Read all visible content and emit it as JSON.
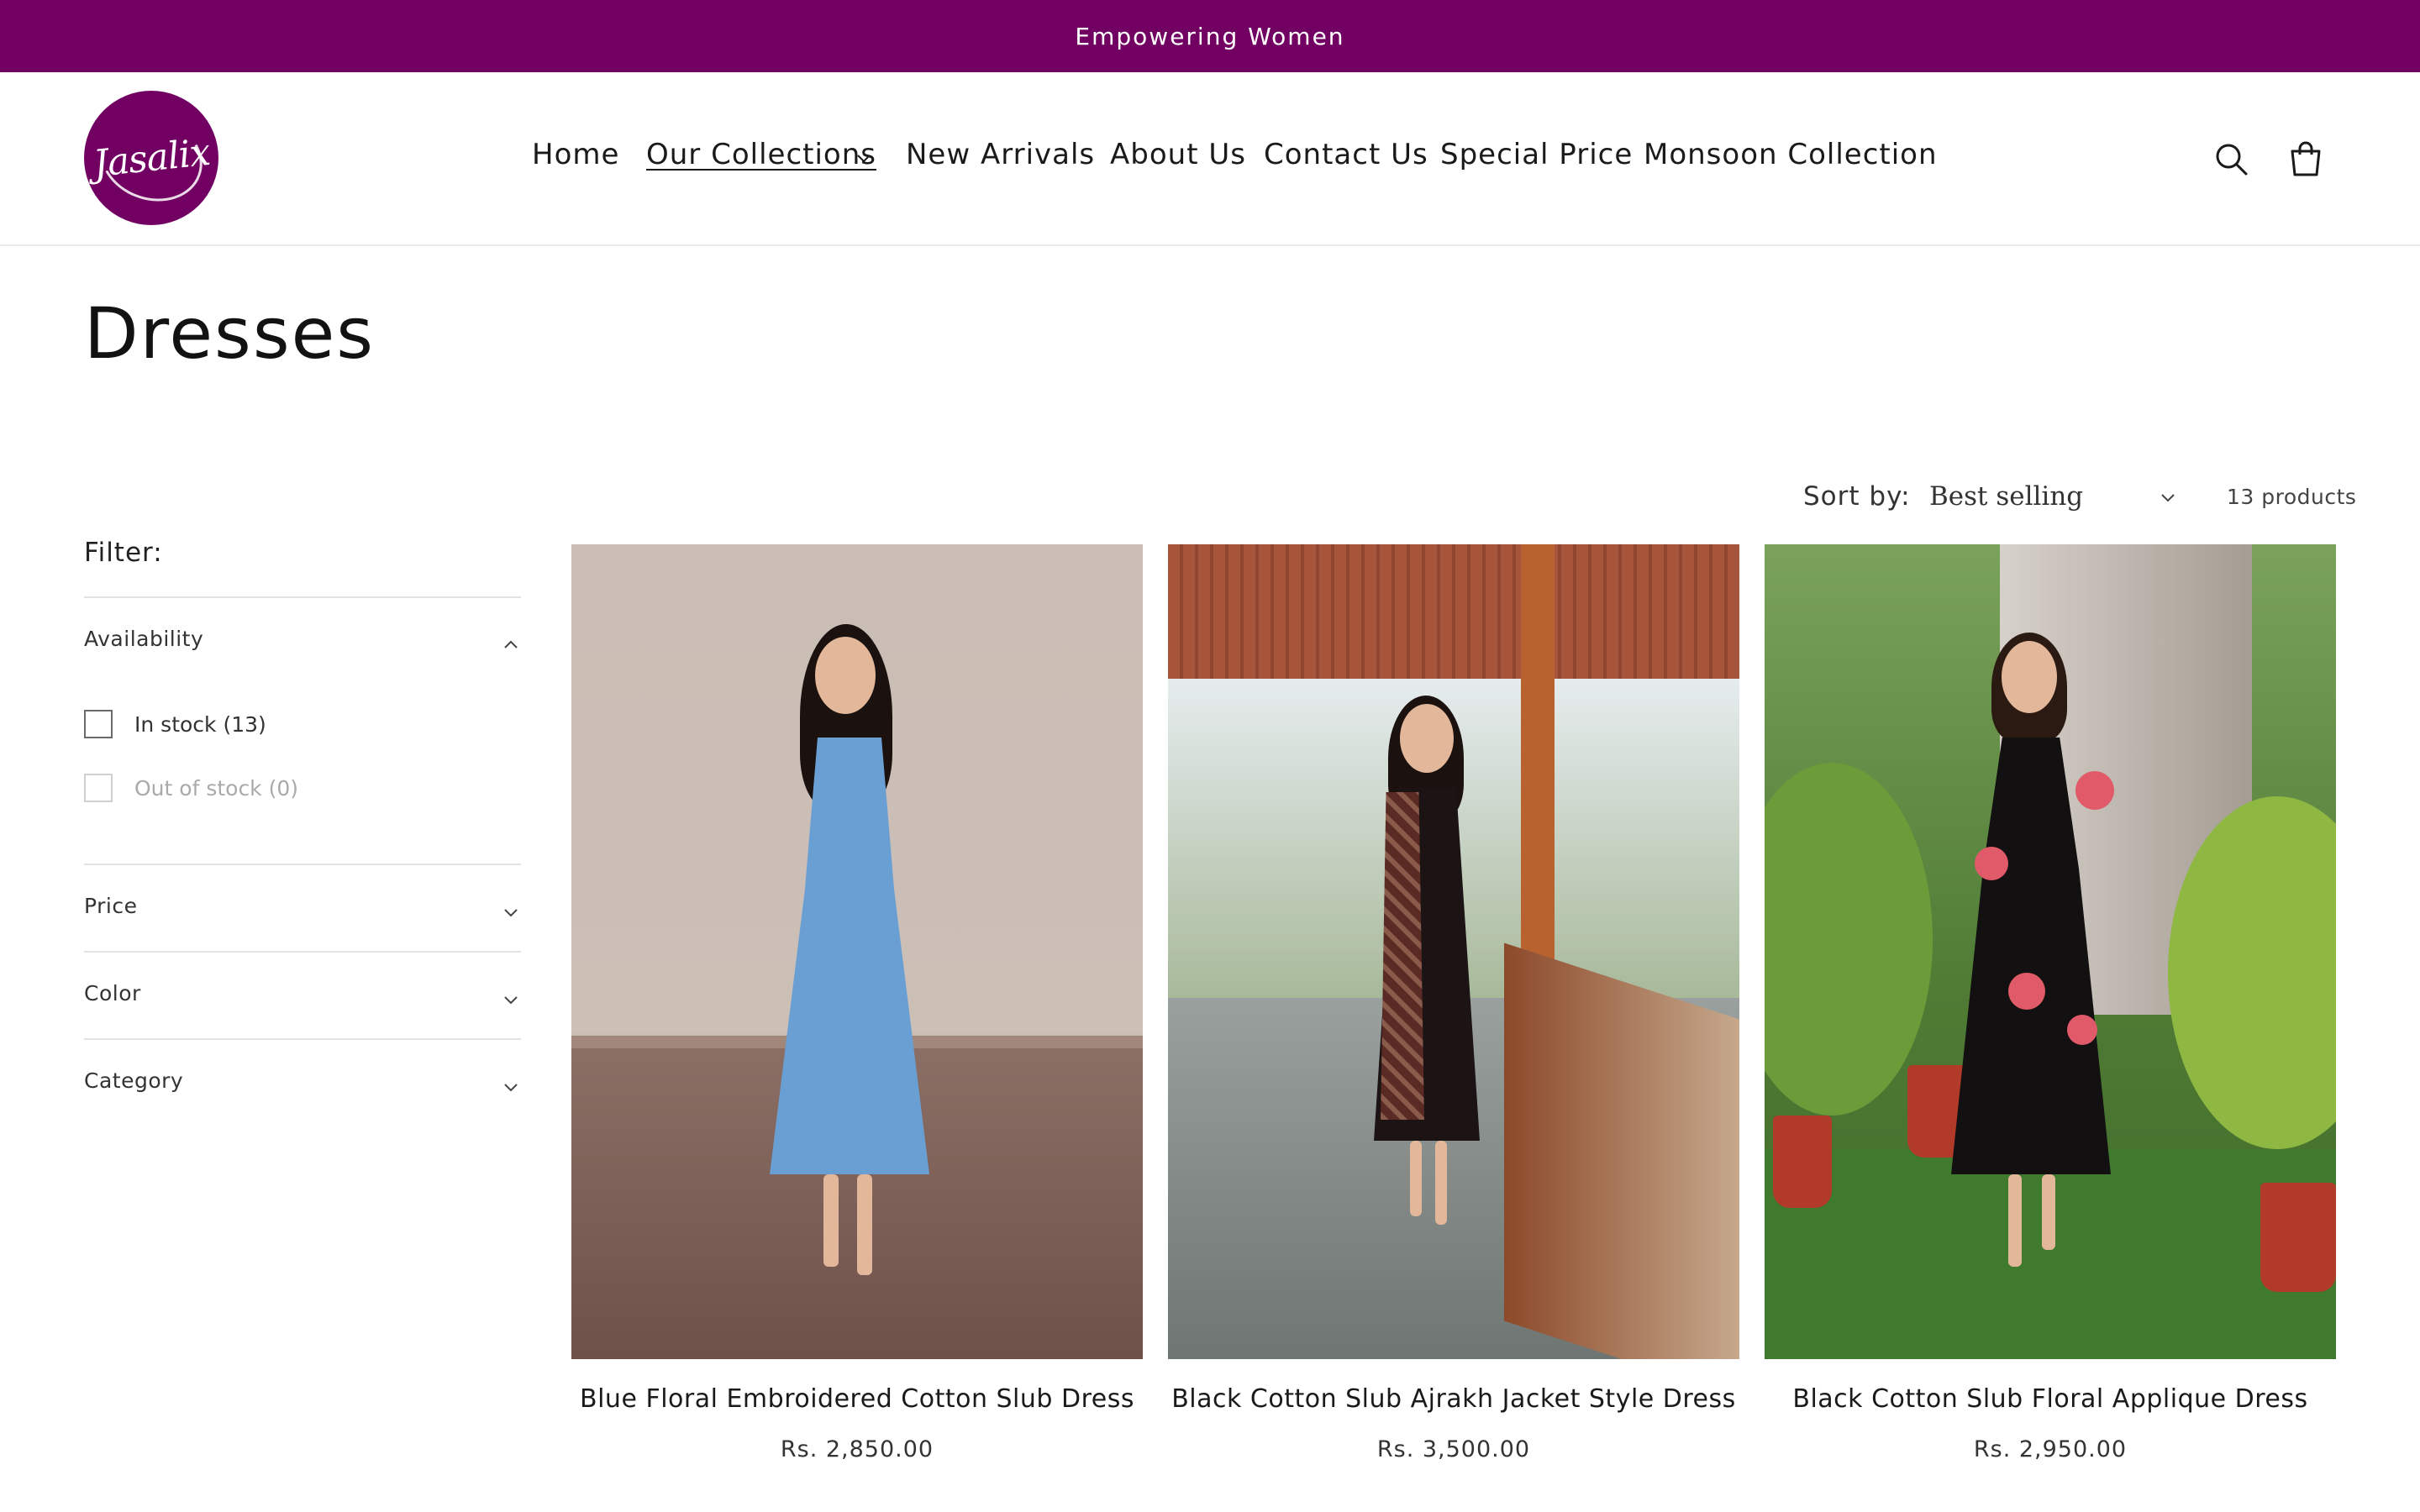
{
  "announcement": {
    "text": "Empowering Women"
  },
  "brand": {
    "logo_text": "Jasalix",
    "accent_color": "#720062"
  },
  "nav": {
    "items": [
      {
        "label": "Home"
      },
      {
        "label": "Our Collections"
      },
      {
        "label": "New Arrivals"
      },
      {
        "label": "About Us"
      },
      {
        "label": "Contact Us"
      },
      {
        "label": "Special Price"
      },
      {
        "label": "Monsoon Collection"
      }
    ],
    "active": "Our Collections",
    "icons": [
      "search-icon",
      "cart-icon"
    ]
  },
  "page": {
    "title": "Dresses"
  },
  "sort": {
    "label": "Sort by:",
    "value": "Best selling",
    "product_count": "13 products"
  },
  "filters": {
    "title": "Filter:",
    "availability": {
      "label": "Availability",
      "expanded": true,
      "options": [
        {
          "label": "In stock (13)",
          "enabled": true
        },
        {
          "label": "Out of stock (0)",
          "enabled": false
        }
      ]
    },
    "price": {
      "label": "Price"
    },
    "color": {
      "label": "Color"
    },
    "category": {
      "label": "Category"
    }
  },
  "products": [
    {
      "name": "Blue Floral Embroidered Cotton Slub Dress",
      "price": "Rs. 2,850.00"
    },
    {
      "name": "Black Cotton Slub Ajrakh Jacket Style Dress",
      "price": "Rs. 3,500.00"
    },
    {
      "name": "Black Cotton Slub Floral Applique Dress",
      "price": "Rs. 2,950.00"
    }
  ]
}
